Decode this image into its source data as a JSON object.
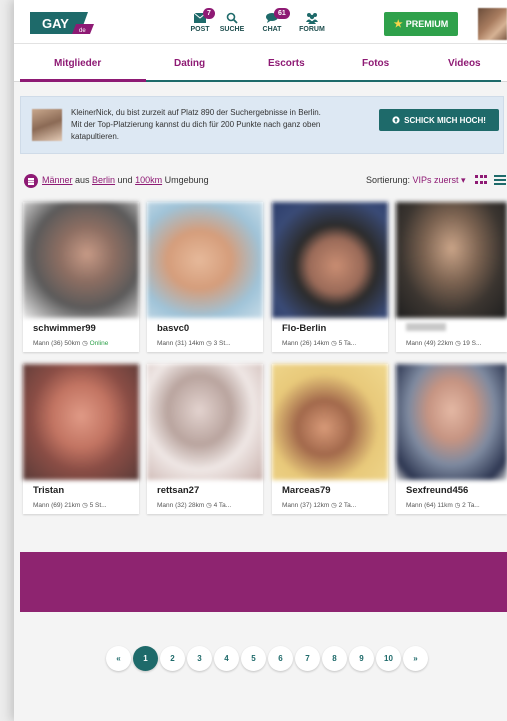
{
  "header": {
    "logo_text": "GAY",
    "logo_suffix": "de",
    "nav": [
      {
        "label": "POST",
        "badge": "7"
      },
      {
        "label": "SUCHE",
        "badge": ""
      },
      {
        "label": "CHAT",
        "badge": "61"
      },
      {
        "label": "FORUM",
        "badge": ""
      }
    ],
    "premium_label": "PREMIUM"
  },
  "tabs": [
    "Mitglieder",
    "Dating",
    "Escorts",
    "Fotos",
    "Videos"
  ],
  "banner": {
    "text": "KleinerNick, du bist zurzeit auf Platz 890 der Suchergebnisse in Berlin. Mit der Top-Platzierung kannst du dich für 200 Punkte nach ganz oben katapultieren.",
    "button": "SCHICK MICH HOCH!"
  },
  "filter": {
    "w1": "Männer",
    "w2": " aus ",
    "w3": "Berlin",
    "w4": " und ",
    "w5": "100km",
    "w6": " Umgebung",
    "sort_label": "Sortierung: ",
    "sort_value": "VIPs zuerst ▾"
  },
  "members": [
    {
      "name": "schwimmer99",
      "meta": "Mann (36) 50km",
      "status": "Online"
    },
    {
      "name": "basvc0",
      "meta": "Mann (31) 14km",
      "status": "3 St..."
    },
    {
      "name": "Flo-Berlin",
      "meta": "Mann (26) 14km",
      "status": "5 Ta..."
    },
    {
      "name": "",
      "meta": "Mann (49) 22km",
      "status": "19 S..."
    },
    {
      "name": "Tristan",
      "meta": "Mann (69) 21km",
      "status": "5 St..."
    },
    {
      "name": "rettsan27",
      "meta": "Mann (32) 28km",
      "status": "4 Ta..."
    },
    {
      "name": "Marceas79",
      "meta": "Mann (37) 12km",
      "status": "2 Ta..."
    },
    {
      "name": "Sexfreund456",
      "meta": "Mann (64) 11km",
      "status": "2 Ta..."
    }
  ],
  "pagination": {
    "prev": "«",
    "pages": [
      "1",
      "2",
      "3",
      "4",
      "5",
      "6",
      "7",
      "8",
      "9",
      "10"
    ],
    "next": "»",
    "current": "1"
  },
  "colors": {
    "brand_teal": "#1e6a6a",
    "brand_purple": "#8e1a74",
    "premium_green": "#2fa14b"
  }
}
